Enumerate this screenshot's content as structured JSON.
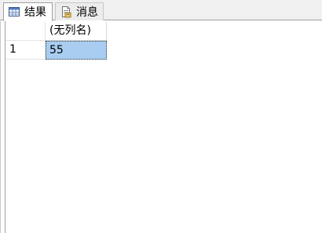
{
  "tabs": [
    {
      "label": "结果",
      "icon": "grid-icon",
      "active": true
    },
    {
      "label": "消息",
      "icon": "message-document-icon",
      "active": false
    }
  ],
  "grid": {
    "columns": [
      "(无列名)"
    ],
    "rows": [
      {
        "row_number": "1",
        "values": [
          "55"
        ]
      }
    ],
    "selected_cell_color": "#a8cdf0"
  }
}
